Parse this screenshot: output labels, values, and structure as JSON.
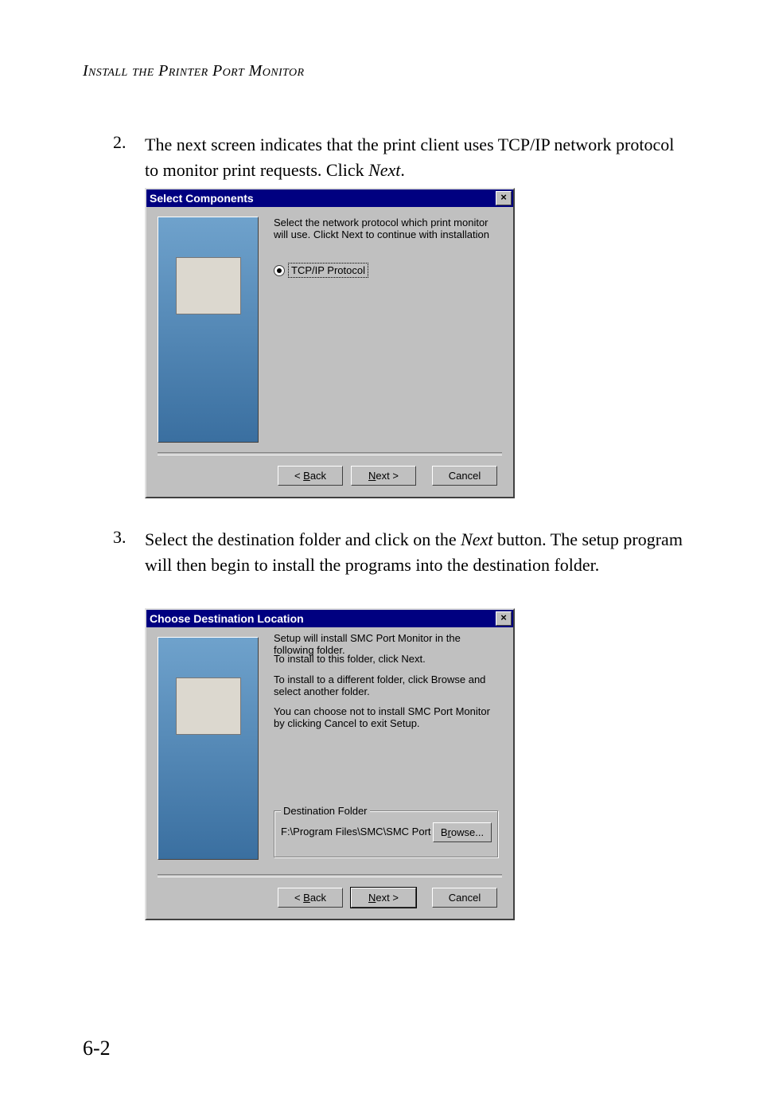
{
  "header": "Install the Printer Port Monitor",
  "step2": {
    "num": "2.",
    "text_a": "The next screen indicates that the print client uses TCP/IP network protocol to monitor print requests. Click ",
    "text_b": "Next",
    "text_c": "."
  },
  "dialog1": {
    "title": "Select Components",
    "close": "×",
    "instr": "Select the network protocol which print monitor will use. Clickt Next to continue with installation",
    "radio_label": "TCP/IP  Protocol",
    "back_u": "B",
    "back": "ack",
    "next_u": "N",
    "next": "ext >",
    "cancel": "Cancel"
  },
  "step3": {
    "num": "3.",
    "text_a": "Select the destination folder and click on the ",
    "text_b": "Next",
    "text_c": " button. The setup program will then begin to install the programs into the destination folder."
  },
  "dialog2": {
    "title": "Choose Destination Location",
    "close": "×",
    "line1": "Setup will install SMC Port Monitor in the following folder.",
    "line2": "To install to this folder, click Next.",
    "line3": "To install to a different folder, click Browse and select another folder.",
    "line4": "You can choose not to install SMC Port Monitor by clicking Cancel to exit Setup.",
    "group_label": "Destination Folder",
    "path": "F:\\Program Files\\SMC\\SMC Port Monitor",
    "browse_pre": "B",
    "browse_u": "r",
    "browse_post": "owse...",
    "back_u": "B",
    "back": "ack",
    "next_u": "N",
    "next": "ext >",
    "cancel": "Cancel"
  },
  "pagenum": "6-2"
}
